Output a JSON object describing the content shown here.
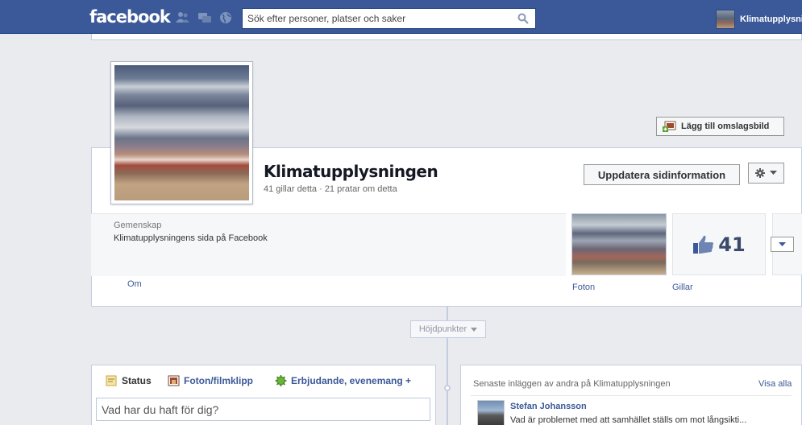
{
  "topbar": {
    "logo": "facebook",
    "search_placeholder": "Sök efter personer, platser och saker",
    "user_name": "Klimatupplysningen",
    "jewels": [
      "friend-requests-icon",
      "messages-icon",
      "notifications-globe-icon"
    ]
  },
  "cover": {
    "add_cover_label": "Lägg till omslagsbild"
  },
  "page": {
    "name": "Klimatupplysningen",
    "stats": "41 gillar detta · 21 pratar om detta",
    "update_button": "Uppdatera sidinformation",
    "category": "Gemenskap",
    "description": "Klimatupplysningens sida på Facebook",
    "about_link": "Om"
  },
  "apps": {
    "photos_label": "Foton",
    "likes_count": "41",
    "likes_label": "Gillar"
  },
  "timeline": {
    "highlights_label": "Höjdpunkter"
  },
  "composer": {
    "tabs": [
      {
        "label": "Status",
        "icon": "status-note-icon"
      },
      {
        "label": "Foton/filmklipp",
        "icon": "photo-icon"
      },
      {
        "label": "Erbjudande, evenemang +",
        "icon": "offer-event-icon"
      }
    ],
    "placeholder": "Vad har du haft för dig?"
  },
  "recent_posts": {
    "title": "Senaste inläggen av andra på Klimatupplysningen",
    "see_all": "Visa alla",
    "posts": [
      {
        "author": "Stefan Johansson",
        "text": "Vad är problemet med att samhället ställs om mot långsikti..."
      }
    ]
  },
  "colors": {
    "brand": "#3b5998",
    "background": "#e9ebee",
    "link": "#3b5998"
  }
}
